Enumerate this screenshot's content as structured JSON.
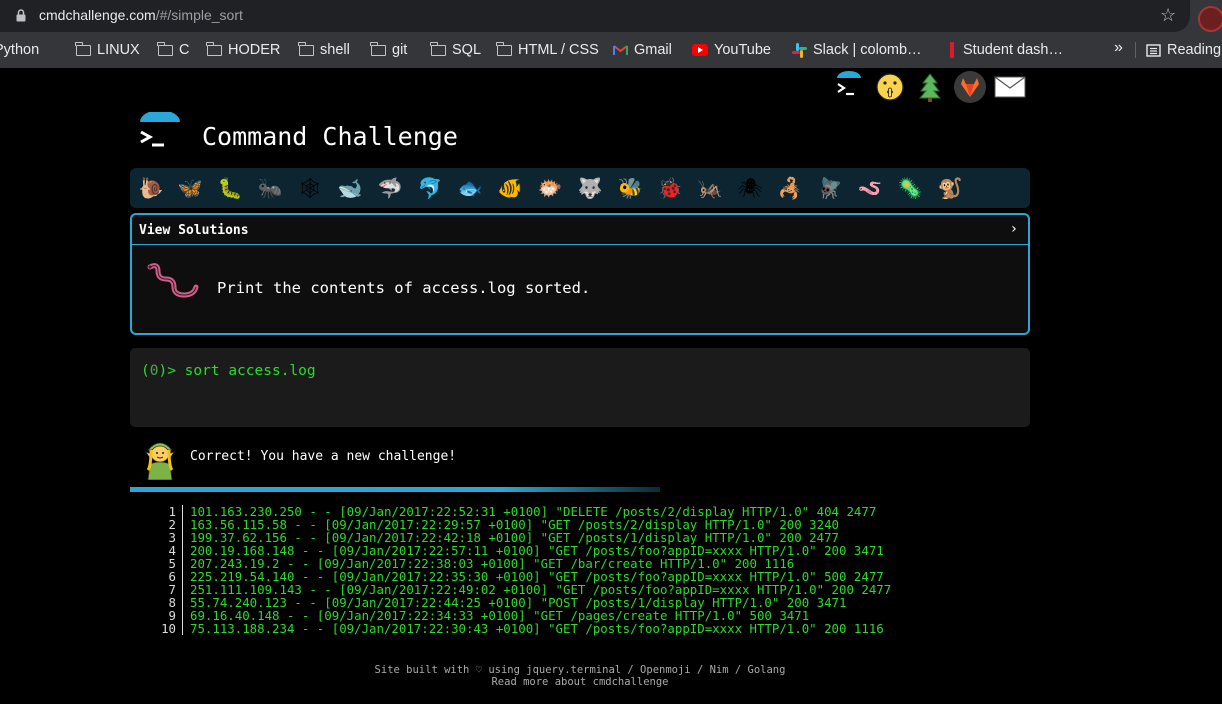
{
  "browser": {
    "url_domain": "cmdchallenge.com",
    "url_path": "/#/simple_sort",
    "bookmarks": [
      {
        "label": "Python",
        "icon": "folder-icon"
      },
      {
        "label": "LINUX",
        "icon": "folder-icon"
      },
      {
        "label": "C",
        "icon": "folder-icon"
      },
      {
        "label": "HODER",
        "icon": "folder-icon"
      },
      {
        "label": "shell",
        "icon": "folder-icon"
      },
      {
        "label": "git",
        "icon": "folder-icon"
      },
      {
        "label": "SQL",
        "icon": "folder-icon"
      },
      {
        "label": "HTML / CSS",
        "icon": "folder-icon"
      },
      {
        "label": "Gmail",
        "icon": "gmail-icon"
      },
      {
        "label": "YouTube",
        "icon": "youtube-icon"
      },
      {
        "label": "Slack | colomb…",
        "icon": "slack-icon"
      },
      {
        "label": "Student dash…",
        "icon": "student-icon"
      },
      {
        "label": "Reading",
        "icon": "reading-list-icon"
      }
    ],
    "overflow": "»"
  },
  "site": {
    "title": "Command Challenge",
    "view_solutions": "View Solutions",
    "view_solutions_arrow": "›",
    "task": "Print the contents of access.log sorted.",
    "prompt_prefix": "(",
    "prompt_count": "0",
    "prompt_suffix": ")> ",
    "command": "sort access.log",
    "correct_message": "Correct! You have a new challenge!",
    "progress": 0.7
  },
  "output": [
    {
      "n": "1",
      "text": "101.163.230.250 - - [09/Jan/2017:22:52:31 +0100] \"DELETE /posts/2/display HTTP/1.0\" 404 2477"
    },
    {
      "n": "2",
      "text": "163.56.115.58 - - [09/Jan/2017:22:29:57 +0100] \"GET /posts/2/display HTTP/1.0\" 200 3240"
    },
    {
      "n": "3",
      "text": "199.37.62.156 - - [09/Jan/2017:22:42:18 +0100] \"GET /posts/1/display HTTP/1.0\" 200 2477"
    },
    {
      "n": "4",
      "text": "200.19.168.148 - - [09/Jan/2017:22:57:11 +0100] \"GET /posts/foo?appID=xxxx HTTP/1.0\" 200 3471"
    },
    {
      "n": "5",
      "text": "207.243.19.2 - - [09/Jan/2017:22:38:03 +0100] \"GET /bar/create HTTP/1.0\" 200 1116"
    },
    {
      "n": "6",
      "text": "225.219.54.140 - - [09/Jan/2017:22:35:30 +0100] \"GET /posts/foo?appID=xxxx HTTP/1.0\" 500 2477"
    },
    {
      "n": "7",
      "text": "251.111.109.143 - - [09/Jan/2017:22:49:02 +0100] \"GET /posts/foo?appID=xxxx HTTP/1.0\" 200 2477"
    },
    {
      "n": "8",
      "text": "55.74.240.123 - - [09/Jan/2017:22:44:25 +0100] \"POST /posts/1/display HTTP/1.0\" 200 3471"
    },
    {
      "n": "9",
      "text": "69.16.40.148 - - [09/Jan/2017:22:34:33 +0100] \"GET /pages/create HTTP/1.0\" 500 3471"
    },
    {
      "n": "10",
      "text": "75.113.188.234 - - [09/Jan/2017:22:30:43 +0100] \"GET /posts/foo?appID=xxxx HTTP/1.0\" 200 1116"
    }
  ],
  "footer": {
    "line1": "Site built with ♡ using jquery.terminal / Openmoji / Nim / Golang",
    "line2": "Read more about cmdchallenge"
  },
  "colors": {
    "accent": "#2aa7d6",
    "terminal_green": "#2adb2a",
    "background": "#000000"
  }
}
